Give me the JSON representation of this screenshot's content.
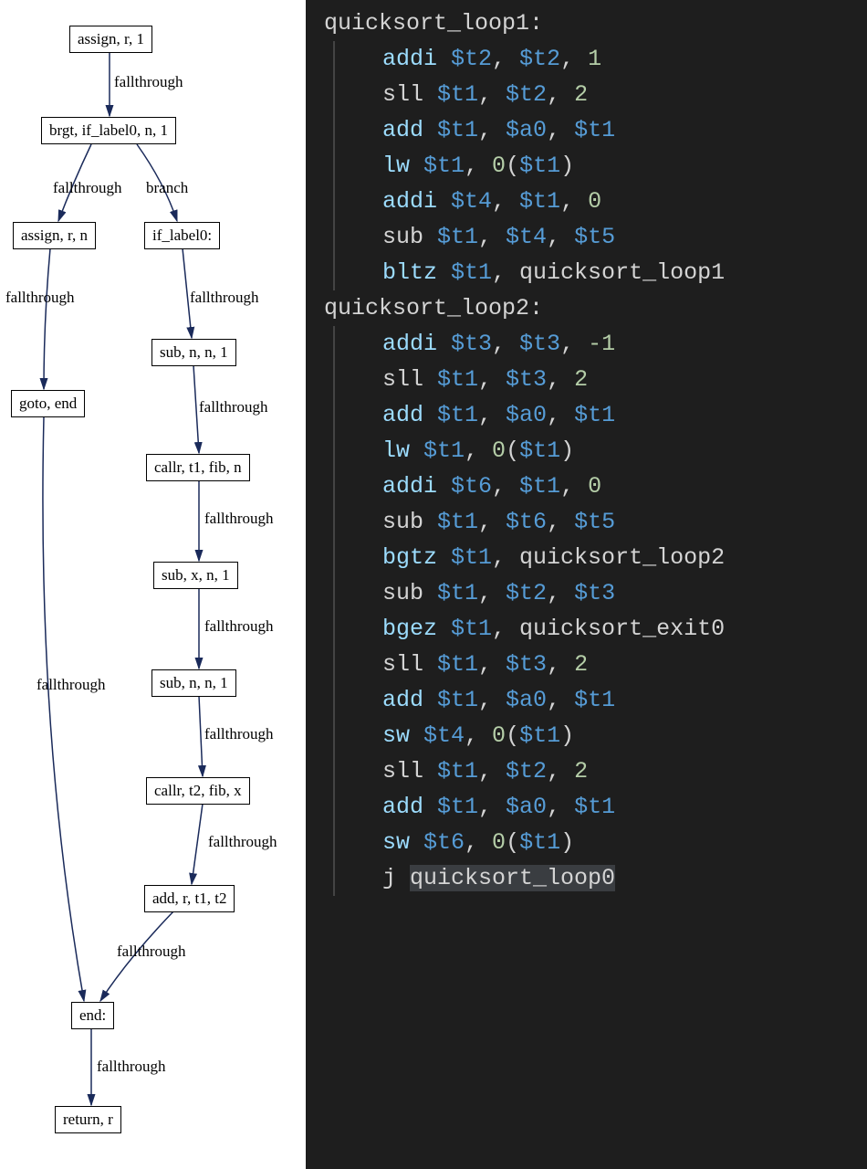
{
  "flowchart": {
    "nodes": {
      "n1": "assign, r, 1",
      "n2": "brgt, if_label0, n, 1",
      "n3": "assign, r, n",
      "n4": "if_label0:",
      "n5": "sub, n, n, 1",
      "n6": "goto, end",
      "n7": "callr, t1, fib, n",
      "n8": "sub, x, n, 1",
      "n9": "sub, n, n, 1",
      "n10": "callr, t2, fib, x",
      "n11": "add, r, t1, t2",
      "n12": "end:",
      "n13": "return, r"
    },
    "edges": {
      "e1": "fallthrough",
      "e2": "fallthrough",
      "e3": "branch",
      "e4": "fallthrough",
      "e5": "fallthrough",
      "e6": "fallthrough",
      "e7": "fallthrough",
      "e8": "fallthrough",
      "e9": "fallthrough",
      "e10": "fallthrough",
      "e11": "fallthrough",
      "e12": "fallthrough",
      "e13": "fallthrough"
    }
  },
  "code": {
    "lines": [
      {
        "type": "label",
        "tokens": [
          {
            "t": "quicksort_loop1:",
            "c": "ident"
          }
        ]
      },
      {
        "type": "indent",
        "tokens": [
          {
            "t": "addi ",
            "c": "mn2"
          },
          {
            "t": "$t2",
            "c": "reg"
          },
          {
            "t": ", ",
            "c": "punct"
          },
          {
            "t": "$t2",
            "c": "reg"
          },
          {
            "t": ", ",
            "c": "punct"
          },
          {
            "t": "1",
            "c": "num"
          }
        ]
      },
      {
        "type": "indent",
        "tokens": [
          {
            "t": "sll ",
            "c": "ident"
          },
          {
            "t": "$t1",
            "c": "reg"
          },
          {
            "t": ", ",
            "c": "punct"
          },
          {
            "t": "$t2",
            "c": "reg"
          },
          {
            "t": ", ",
            "c": "punct"
          },
          {
            "t": "2",
            "c": "num"
          }
        ]
      },
      {
        "type": "indent",
        "tokens": [
          {
            "t": "add ",
            "c": "mn2"
          },
          {
            "t": "$t1",
            "c": "reg"
          },
          {
            "t": ", ",
            "c": "punct"
          },
          {
            "t": "$a0",
            "c": "reg"
          },
          {
            "t": ", ",
            "c": "punct"
          },
          {
            "t": "$t1",
            "c": "reg"
          }
        ]
      },
      {
        "type": "indent",
        "tokens": [
          {
            "t": "lw ",
            "c": "mn2"
          },
          {
            "t": "$t1",
            "c": "reg"
          },
          {
            "t": ", ",
            "c": "punct"
          },
          {
            "t": "0",
            "c": "num"
          },
          {
            "t": "(",
            "c": "punct"
          },
          {
            "t": "$t1",
            "c": "reg"
          },
          {
            "t": ")",
            "c": "punct"
          }
        ]
      },
      {
        "type": "indent",
        "tokens": [
          {
            "t": "addi ",
            "c": "mn2"
          },
          {
            "t": "$t4",
            "c": "reg"
          },
          {
            "t": ", ",
            "c": "punct"
          },
          {
            "t": "$t1",
            "c": "reg"
          },
          {
            "t": ", ",
            "c": "punct"
          },
          {
            "t": "0",
            "c": "num"
          }
        ]
      },
      {
        "type": "indent",
        "tokens": [
          {
            "t": "sub ",
            "c": "ident"
          },
          {
            "t": "$t1",
            "c": "reg"
          },
          {
            "t": ", ",
            "c": "punct"
          },
          {
            "t": "$t4",
            "c": "reg"
          },
          {
            "t": ", ",
            "c": "punct"
          },
          {
            "t": "$t5",
            "c": "reg"
          }
        ]
      },
      {
        "type": "indent",
        "tokens": [
          {
            "t": "bltz ",
            "c": "mn2"
          },
          {
            "t": "$t1",
            "c": "reg"
          },
          {
            "t": ", ",
            "c": "punct"
          },
          {
            "t": "quicksort_loop1",
            "c": "ident"
          }
        ]
      },
      {
        "type": "label",
        "tokens": [
          {
            "t": "quicksort_loop2:",
            "c": "ident"
          }
        ]
      },
      {
        "type": "indent",
        "tokens": [
          {
            "t": "addi ",
            "c": "mn2"
          },
          {
            "t": "$t3",
            "c": "reg"
          },
          {
            "t": ", ",
            "c": "punct"
          },
          {
            "t": "$t3",
            "c": "reg"
          },
          {
            "t": ", ",
            "c": "punct"
          },
          {
            "t": "-1",
            "c": "num"
          }
        ]
      },
      {
        "type": "indent",
        "tokens": [
          {
            "t": "sll ",
            "c": "ident"
          },
          {
            "t": "$t1",
            "c": "reg"
          },
          {
            "t": ", ",
            "c": "punct"
          },
          {
            "t": "$t3",
            "c": "reg"
          },
          {
            "t": ", ",
            "c": "punct"
          },
          {
            "t": "2",
            "c": "num"
          }
        ]
      },
      {
        "type": "indent",
        "tokens": [
          {
            "t": "add ",
            "c": "mn2"
          },
          {
            "t": "$t1",
            "c": "reg"
          },
          {
            "t": ", ",
            "c": "punct"
          },
          {
            "t": "$a0",
            "c": "reg"
          },
          {
            "t": ", ",
            "c": "punct"
          },
          {
            "t": "$t1",
            "c": "reg"
          }
        ]
      },
      {
        "type": "indent",
        "tokens": [
          {
            "t": "lw ",
            "c": "mn2"
          },
          {
            "t": "$t1",
            "c": "reg"
          },
          {
            "t": ", ",
            "c": "punct"
          },
          {
            "t": "0",
            "c": "num"
          },
          {
            "t": "(",
            "c": "punct"
          },
          {
            "t": "$t1",
            "c": "reg"
          },
          {
            "t": ")",
            "c": "punct"
          }
        ]
      },
      {
        "type": "indent",
        "tokens": [
          {
            "t": "addi ",
            "c": "mn2"
          },
          {
            "t": "$t6",
            "c": "reg"
          },
          {
            "t": ", ",
            "c": "punct"
          },
          {
            "t": "$t1",
            "c": "reg"
          },
          {
            "t": ", ",
            "c": "punct"
          },
          {
            "t": "0",
            "c": "num"
          }
        ]
      },
      {
        "type": "indent",
        "tokens": [
          {
            "t": "sub ",
            "c": "ident"
          },
          {
            "t": "$t1",
            "c": "reg"
          },
          {
            "t": ", ",
            "c": "punct"
          },
          {
            "t": "$t6",
            "c": "reg"
          },
          {
            "t": ", ",
            "c": "punct"
          },
          {
            "t": "$t5",
            "c": "reg"
          }
        ]
      },
      {
        "type": "indent",
        "tokens": [
          {
            "t": "bgtz ",
            "c": "mn2"
          },
          {
            "t": "$t1",
            "c": "reg"
          },
          {
            "t": ", ",
            "c": "punct"
          },
          {
            "t": "quicksort_loop2",
            "c": "ident"
          }
        ]
      },
      {
        "type": "indent",
        "tokens": [
          {
            "t": "sub ",
            "c": "ident"
          },
          {
            "t": "$t1",
            "c": "reg"
          },
          {
            "t": ", ",
            "c": "punct"
          },
          {
            "t": "$t2",
            "c": "reg"
          },
          {
            "t": ", ",
            "c": "punct"
          },
          {
            "t": "$t3",
            "c": "reg"
          }
        ]
      },
      {
        "type": "indent",
        "tokens": [
          {
            "t": "bgez ",
            "c": "mn2"
          },
          {
            "t": "$t1",
            "c": "reg"
          },
          {
            "t": ", ",
            "c": "punct"
          },
          {
            "t": "quicksort_exit0",
            "c": "ident"
          }
        ]
      },
      {
        "type": "indent",
        "tokens": [
          {
            "t": "sll ",
            "c": "ident"
          },
          {
            "t": "$t1",
            "c": "reg"
          },
          {
            "t": ", ",
            "c": "punct"
          },
          {
            "t": "$t3",
            "c": "reg"
          },
          {
            "t": ", ",
            "c": "punct"
          },
          {
            "t": "2",
            "c": "num"
          }
        ]
      },
      {
        "type": "indent",
        "tokens": [
          {
            "t": "add ",
            "c": "mn2"
          },
          {
            "t": "$t1",
            "c": "reg"
          },
          {
            "t": ", ",
            "c": "punct"
          },
          {
            "t": "$a0",
            "c": "reg"
          },
          {
            "t": ", ",
            "c": "punct"
          },
          {
            "t": "$t1",
            "c": "reg"
          }
        ]
      },
      {
        "type": "indent",
        "tokens": [
          {
            "t": "sw ",
            "c": "mn2"
          },
          {
            "t": "$t4",
            "c": "reg"
          },
          {
            "t": ", ",
            "c": "punct"
          },
          {
            "t": "0",
            "c": "num"
          },
          {
            "t": "(",
            "c": "punct"
          },
          {
            "t": "$t1",
            "c": "reg"
          },
          {
            "t": ")",
            "c": "punct"
          }
        ]
      },
      {
        "type": "indent",
        "tokens": [
          {
            "t": "sll ",
            "c": "ident"
          },
          {
            "t": "$t1",
            "c": "reg"
          },
          {
            "t": ", ",
            "c": "punct"
          },
          {
            "t": "$t2",
            "c": "reg"
          },
          {
            "t": ", ",
            "c": "punct"
          },
          {
            "t": "2",
            "c": "num"
          }
        ]
      },
      {
        "type": "indent",
        "tokens": [
          {
            "t": "add ",
            "c": "mn2"
          },
          {
            "t": "$t1",
            "c": "reg"
          },
          {
            "t": ", ",
            "c": "punct"
          },
          {
            "t": "$a0",
            "c": "reg"
          },
          {
            "t": ", ",
            "c": "punct"
          },
          {
            "t": "$t1",
            "c": "reg"
          }
        ]
      },
      {
        "type": "indent",
        "tokens": [
          {
            "t": "sw ",
            "c": "mn2"
          },
          {
            "t": "$t6",
            "c": "reg"
          },
          {
            "t": ", ",
            "c": "punct"
          },
          {
            "t": "0",
            "c": "num"
          },
          {
            "t": "(",
            "c": "punct"
          },
          {
            "t": "$t1",
            "c": "reg"
          },
          {
            "t": ")",
            "c": "punct"
          }
        ]
      },
      {
        "type": "indent",
        "tokens": [
          {
            "t": "j ",
            "c": "ident"
          },
          {
            "t": "quicksort_loop0",
            "c": "ident",
            "cursor": true
          }
        ]
      }
    ]
  }
}
